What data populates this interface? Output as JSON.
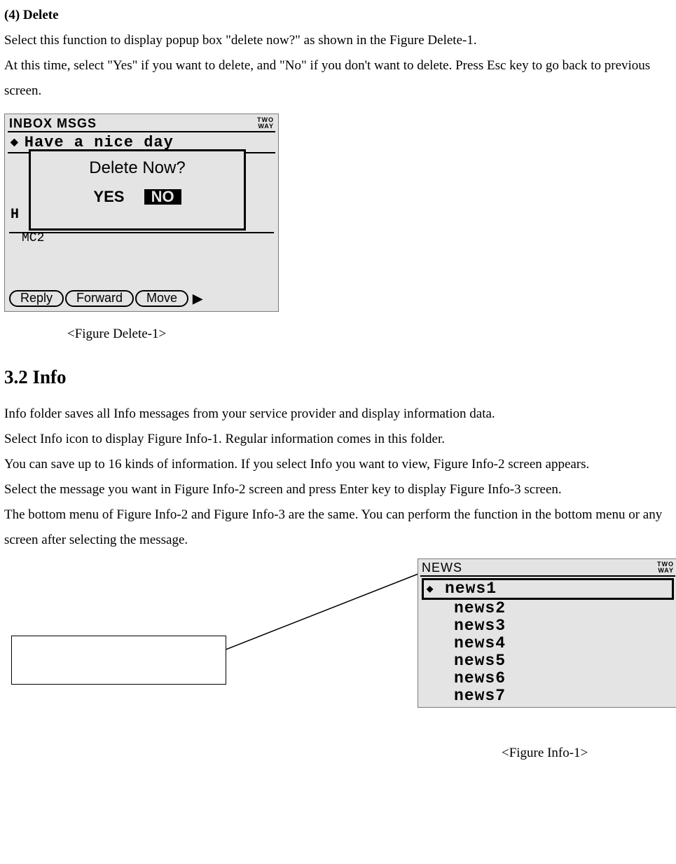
{
  "sec4": {
    "title": "(4) Delete",
    "p1": "Select this function to display popup box \"delete now?\" as shown in the Figure Delete-1.",
    "p2": "At this time, select \"Yes\" if you want to delete, and \"No\" if you don't want to delete. Press Esc key to go back to previous screen."
  },
  "fig_delete": {
    "screen_title": "INBOX MSGS",
    "indicator": "TWO WAY",
    "message_line": "Have a nice day",
    "popup_question": "Delete Now?",
    "yes": "YES",
    "no": "NO",
    "h_text": "H",
    "mc2": "MC2",
    "softkeys": [
      "Reply",
      "Forward",
      "Move"
    ],
    "caption": "<Figure Delete-1>"
  },
  "sec32": {
    "title": "3.2 Info",
    "p1": "Info folder saves all Info messages from your service provider and display information data.",
    "p2": "Select Info icon to display Figure Info-1. Regular information comes in this folder.",
    "p3": "You can save up to 16 kinds of information. If you select Info you want to view, Figure Info-2 screen appears.",
    "p4": "Select the message you want in Figure Info-2 screen and press Enter key to display Figure Info-3 screen.",
    "p5": "The bottom menu of Figure Info-2 and Figure Info-3 are the same. You can perform the function in the bottom menu or any screen after selecting the message."
  },
  "fig_info": {
    "screen_title": "NEWS",
    "indicator": "TWO WAY",
    "items": [
      "news1",
      "news2",
      "news3",
      "news4",
      "news5",
      "news6",
      "news7"
    ],
    "caption": "<Figure Info-1>"
  }
}
